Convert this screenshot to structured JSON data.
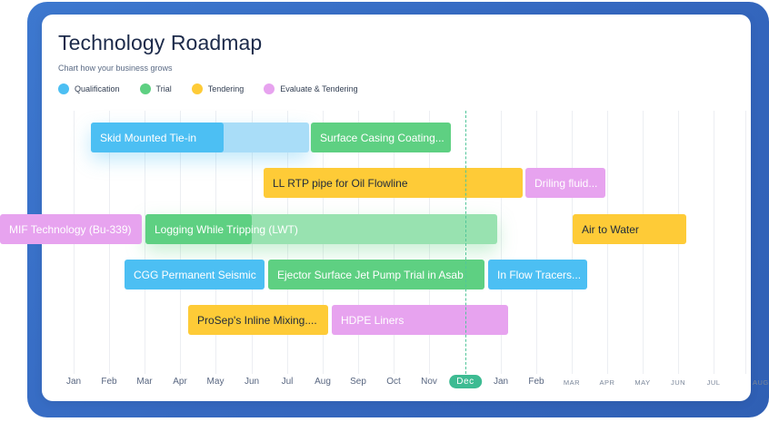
{
  "roadmap": {
    "title": "Technology Roadmap",
    "subtitle": "Chart how your business grows"
  },
  "legend": [
    {
      "label": "Qualification",
      "color": "#4cbff3"
    },
    {
      "label": "Trial",
      "color": "#5ed082"
    },
    {
      "label": "Tendering",
      "color": "#fecb37"
    },
    {
      "label": "Evaluate & Tendering",
      "color": "#e7a3ef"
    }
  ],
  "timeline": {
    "months": [
      "Jan",
      "Feb",
      "Mar",
      "Apr",
      "May",
      "Jun",
      "Jul",
      "Aug",
      "Sep",
      "Oct",
      "Nov",
      "Dec",
      "Jan",
      "Feb",
      "MAR",
      "APR",
      "MAY",
      "JUN",
      "JUL",
      "AUG"
    ],
    "current_month": "Dec"
  },
  "bars": {
    "skid": "Skid Mounted Tie-in",
    "surface_casing": "Surface Casing Coating...",
    "ll_rtp": "LL RTP pipe for Oil Flowline",
    "drilling_fluid": "Driling fluid...",
    "mif": "MIF Technology (Bu-339)",
    "logging": "Logging While Tripping (LWT)",
    "air_water": "Air to Water",
    "cgg": "CGG Permanent Seismic",
    "ejector": "Ejector Surface Jet Pump Trial in Asab",
    "flow_tracers": "In Flow Tracers...",
    "prosep": "ProSep's Inline Mixing....",
    "hdpe": "HDPE Liners"
  }
}
